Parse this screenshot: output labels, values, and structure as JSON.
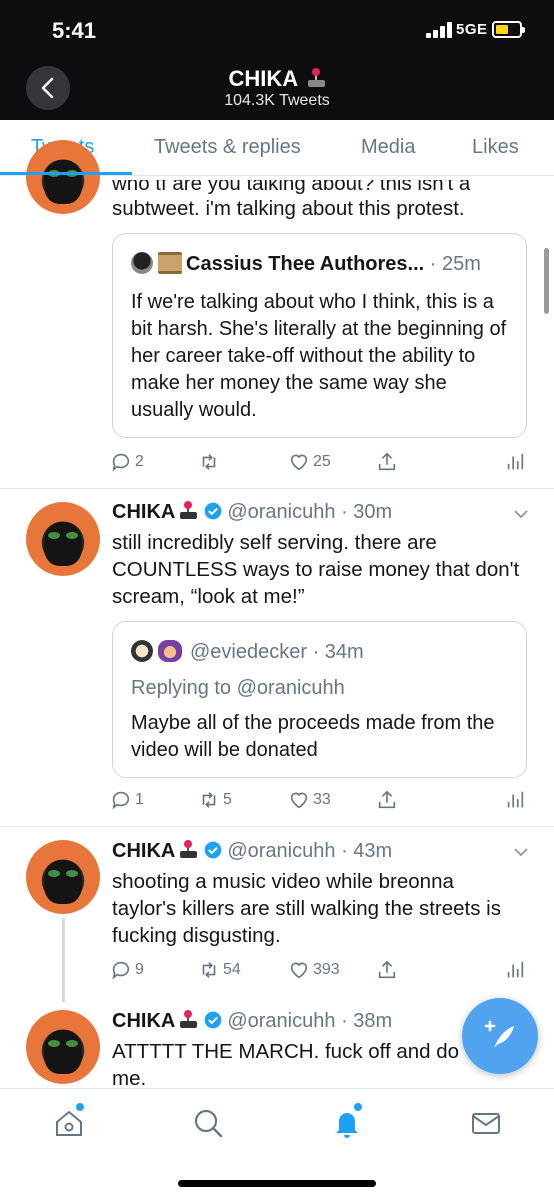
{
  "status": {
    "time": "5:41",
    "network": "5GE"
  },
  "header": {
    "name": "CHIKA",
    "tweet_count": "104.3K Tweets"
  },
  "tabs": [
    {
      "label": "Tweets",
      "active": true
    },
    {
      "label": "Tweets & replies",
      "active": false
    },
    {
      "label": "Media",
      "active": false
    },
    {
      "label": "Likes",
      "active": false
    }
  ],
  "tweets": [
    {
      "text_partial": "who tf are you talking about? this isn't a",
      "text_line2": "subtweet. i'm talking about this protest.",
      "quote": {
        "name": "Cassius Thee Authores...",
        "time": "· 25m",
        "text": "If we're talking about who I think, this is a bit harsh. She's literally at the beginning of her career take-off without the ability to make her money the same way she usually would."
      },
      "replies": "2",
      "retweets": "",
      "likes": "25"
    },
    {
      "name": "CHIKA",
      "handle": "@oranicuhh",
      "time": "· 30m",
      "text": "still incredibly self serving. there are COUNTLESS ways to raise money that don't scream, “look at me!”",
      "quote": {
        "name": "@eviedecker",
        "time": "· 34m",
        "replying_to": "Replying to @oranicuhh",
        "text": "Maybe all of the proceeds made from the video will be donated"
      },
      "replies": "1",
      "retweets": "5",
      "likes": "33"
    },
    {
      "name": "CHIKA",
      "handle": "@oranicuhh",
      "time": "· 43m",
      "text": "shooting a music video while breonna taylor's killers are still walking the streets is fucking disgusting.",
      "replies": "9",
      "retweets": "54",
      "likes": "393"
    },
    {
      "name": "CHIKA",
      "handle": "@oranicuhh",
      "time": "· 38m",
      "text": "ATTTTT THE MARCH. fuck off and do me."
    }
  ],
  "colors": {
    "accent": "#1da1f2",
    "header_bg": "#0e0e10",
    "secondary_text": "#657786",
    "fab": "#4fa3ef"
  }
}
